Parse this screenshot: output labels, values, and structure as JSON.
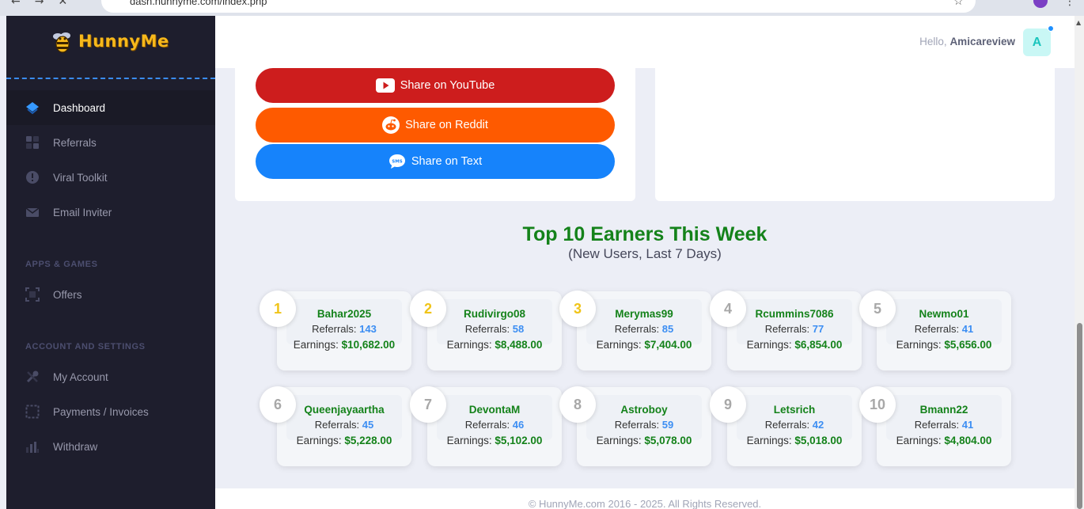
{
  "browser": {
    "url": "dash.hunnyme.com/index.php"
  },
  "brand": {
    "name": "HunnyMe"
  },
  "sidebar": {
    "items": [
      {
        "label": "Dashboard",
        "icon": "layers-icon"
      },
      {
        "label": "Referrals",
        "icon": "grid-icon"
      },
      {
        "label": "Viral Toolkit",
        "icon": "alert-circle-icon"
      },
      {
        "label": "Email Inviter",
        "icon": "envelope-icon"
      }
    ],
    "section_apps": "APPS & GAMES",
    "apps_items": [
      {
        "label": "Offers",
        "icon": "frame-icon"
      }
    ],
    "section_account": "ACCOUNT AND SETTINGS",
    "account_items": [
      {
        "label": "My Account",
        "icon": "tools-icon"
      },
      {
        "label": "Payments / Invoices",
        "icon": "dashed-frame-icon"
      },
      {
        "label": "Withdraw",
        "icon": "bar-chart-icon"
      }
    ]
  },
  "header": {
    "greeting": "Hello,",
    "username": "Amicareview",
    "avatar_letter": "A"
  },
  "share": {
    "youtube": "Share on YouTube",
    "reddit": "Share on Reddit",
    "text": "Share on Text"
  },
  "leaderboard": {
    "title": "Top 10 Earners This Week",
    "subtitle": "(New Users, Last 7 Days)",
    "referrals_label": "Referrals:",
    "earnings_label": "Earnings:",
    "earners": [
      {
        "rank": "1",
        "name": "Bahar2025",
        "referrals": "143",
        "earnings": "$10,682.00"
      },
      {
        "rank": "2",
        "name": "Rudivirgo08",
        "referrals": "58",
        "earnings": "$8,488.00"
      },
      {
        "rank": "3",
        "name": "Merymas99",
        "referrals": "85",
        "earnings": "$7,404.00"
      },
      {
        "rank": "4",
        "name": "Rcummins7086",
        "referrals": "77",
        "earnings": "$6,854.00"
      },
      {
        "rank": "5",
        "name": "Newmo01",
        "referrals": "41",
        "earnings": "$5,656.00"
      },
      {
        "rank": "6",
        "name": "Queenjayaartha",
        "referrals": "45",
        "earnings": "$5,228.00"
      },
      {
        "rank": "7",
        "name": "DevontaM",
        "referrals": "46",
        "earnings": "$5,102.00"
      },
      {
        "rank": "8",
        "name": "Astroboy",
        "referrals": "59",
        "earnings": "$5,078.00"
      },
      {
        "rank": "9",
        "name": "Letsrich",
        "referrals": "42",
        "earnings": "$5,018.00"
      },
      {
        "rank": "10",
        "name": "Bmann22",
        "referrals": "41",
        "earnings": "$4,804.00"
      }
    ]
  },
  "footer": {
    "text": "© HunnyMe.com 2016 - 2025. All Rights Reserved."
  },
  "colors": {
    "sidebar_bg": "#1e1e2d",
    "accent_green": "#14821a",
    "accent_blue": "#3c8ef3",
    "youtube_red": "#cd1d1d",
    "reddit_orange": "#fe5a00",
    "text_blue": "#1683fb",
    "gold_rank": "#f0c419"
  }
}
